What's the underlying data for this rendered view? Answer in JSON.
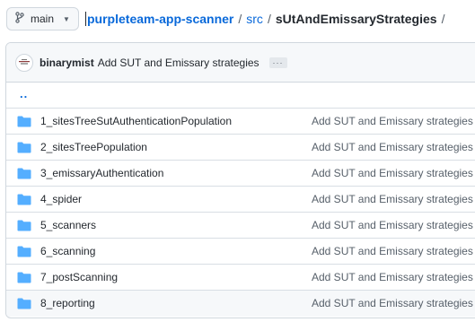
{
  "branch": {
    "label": "main"
  },
  "breadcrumb": {
    "repo": "purpleteam-app-scanner",
    "sep1": "/",
    "dir1": "src",
    "sep2": "/",
    "current": "sUtAndEmissaryStrategies",
    "sep3": "/"
  },
  "commit": {
    "author": "binarymist",
    "message": "Add SUT and Emissary strategies",
    "ellipsis": "···"
  },
  "parent_dir": "..",
  "files": [
    {
      "name": "1_sitesTreeSutAuthenticationPopulation",
      "message": "Add SUT and Emissary strategies"
    },
    {
      "name": "2_sitesTreePopulation",
      "message": "Add SUT and Emissary strategies"
    },
    {
      "name": "3_emissaryAuthentication",
      "message": "Add SUT and Emissary strategies"
    },
    {
      "name": "4_spider",
      "message": "Add SUT and Emissary strategies"
    },
    {
      "name": "5_scanners",
      "message": "Add SUT and Emissary strategies"
    },
    {
      "name": "6_scanning",
      "message": "Add SUT and Emissary strategies"
    },
    {
      "name": "7_postScanning",
      "message": "Add SUT and Emissary strategies"
    },
    {
      "name": "8_reporting",
      "message": "Add SUT and Emissary strategies"
    }
  ],
  "colors": {
    "folder": "#54aeff",
    "link": "#0969da"
  },
  "icons": {
    "branch": "git-branch-icon",
    "folder": "folder-icon",
    "caret": "chevron-down-icon"
  }
}
